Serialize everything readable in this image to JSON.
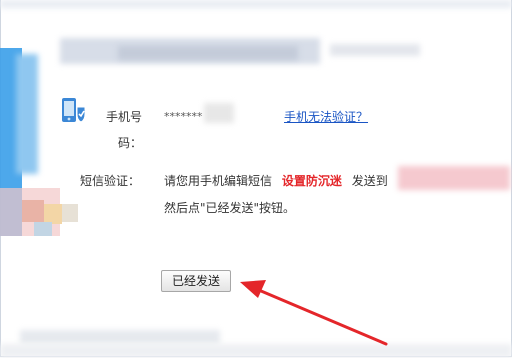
{
  "form": {
    "phone_label_line1": "手机号",
    "phone_label_line2": "码：",
    "phone_value_masked": "*******",
    "help_link": "手机无法验证？",
    "sms_label": "短信验证：",
    "sms_msg_part1": "请您用手机编辑短信",
    "sms_keyword": "设置防沉迷",
    "sms_msg_part2": "发送到",
    "sms_msg_line2": "然后点\"已经发送\"按钮。",
    "sent_button": "已经发送"
  },
  "icons": {
    "phone": "phone-shield-icon",
    "arrow": "red-pointer-arrow-icon"
  },
  "colors": {
    "accent_red": "#e4262a",
    "link_blue": "#1a55c4",
    "icon_blue": "#3b87d6"
  }
}
